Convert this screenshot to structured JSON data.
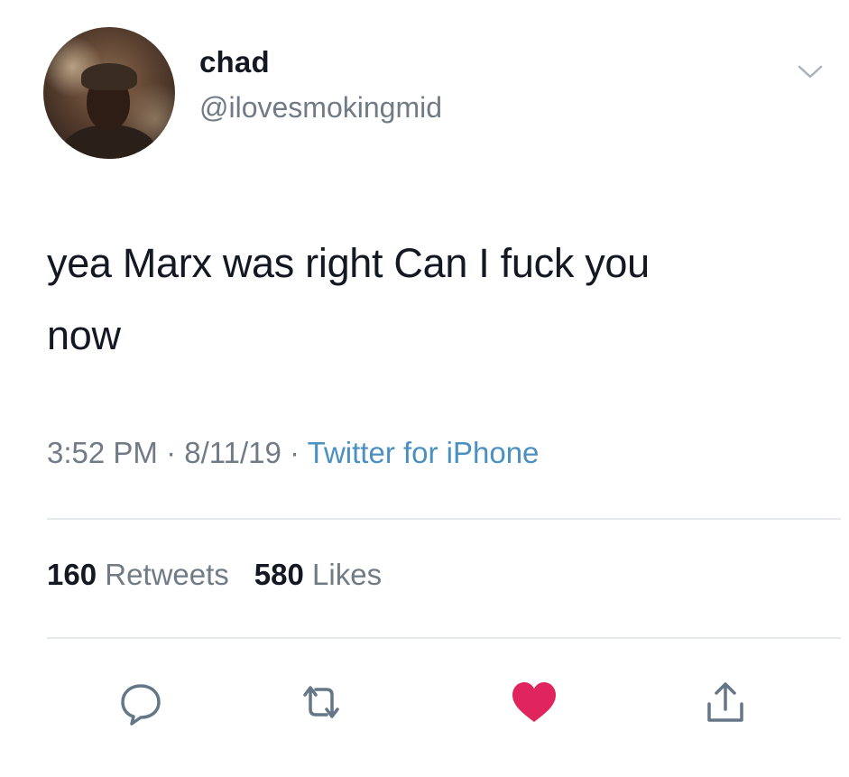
{
  "tweet": {
    "author": {
      "name": "chad",
      "handle": "@ilovesmokingmid"
    },
    "text_line1": "yea Marx was right Can I fuck you",
    "text_line2": "now",
    "meta": {
      "time": "3:52 PM",
      "sep1": " · ",
      "date": "8/11/19",
      "sep2": " · ",
      "source": "Twitter for iPhone"
    },
    "stats": {
      "retweets_count": "160",
      "retweets_label": "Retweets",
      "likes_count": "580",
      "likes_label": "Likes"
    },
    "actions": {
      "reply_icon": "speech-bubble-icon",
      "retweet_icon": "retweet-arrows-icon",
      "like_icon": "heart-icon",
      "share_icon": "share-upload-icon"
    }
  },
  "colors": {
    "text_primary": "#141823",
    "text_secondary": "#707b85",
    "link": "#4a90c2",
    "like_red": "#e0245e",
    "icon_gray": "#657786",
    "divider": "#e6e9ec"
  }
}
